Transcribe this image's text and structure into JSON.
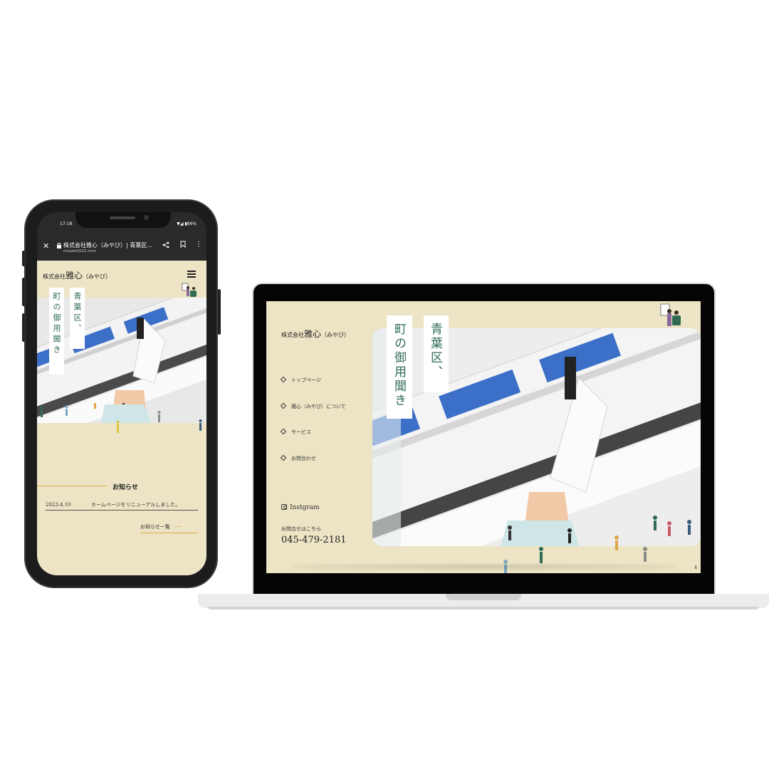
{
  "phone": {
    "status_time": "17:18",
    "status_right": "▼◢ ▮86%",
    "browser": {
      "close_icon": "✕",
      "lock_icon": "🔒",
      "title": "株式会社雅心（みやび）| 青葉区...",
      "url": "miyabi2022.com",
      "share_icon": "share-icon",
      "bookmark_icon": "bookmark-icon",
      "more_icon": "⋮"
    },
    "logo_prefix": "株式会社",
    "logo_main": "雅心",
    "logo_suffix": "（みやび）",
    "hero_v1": "青葉区、",
    "hero_v2": "町の御用聞き",
    "news": {
      "title": "お知らせ",
      "date": "2023.4.10",
      "text": "ホームページをリニューアルしました。",
      "more": "お知らせ一覧",
      "arrow": "⟶"
    }
  },
  "laptop": {
    "logo_prefix": "株式会社",
    "logo_main": "雅心",
    "logo_suffix": "（みやび）",
    "nav": [
      "トップページ",
      "雅心（みやび）について",
      "サービス",
      "お問合わせ"
    ],
    "instagram": "Instgram",
    "contact_label": "お問合せはこちら",
    "phone": "045-479-2181",
    "hero_v1": "青葉区、",
    "hero_v2": "町の御用聞き",
    "page_num": "4"
  },
  "colors": {
    "page_bg": "#ece4c4",
    "accent_green": "#2f6b52",
    "accent_orange": "#e0a64a"
  }
}
